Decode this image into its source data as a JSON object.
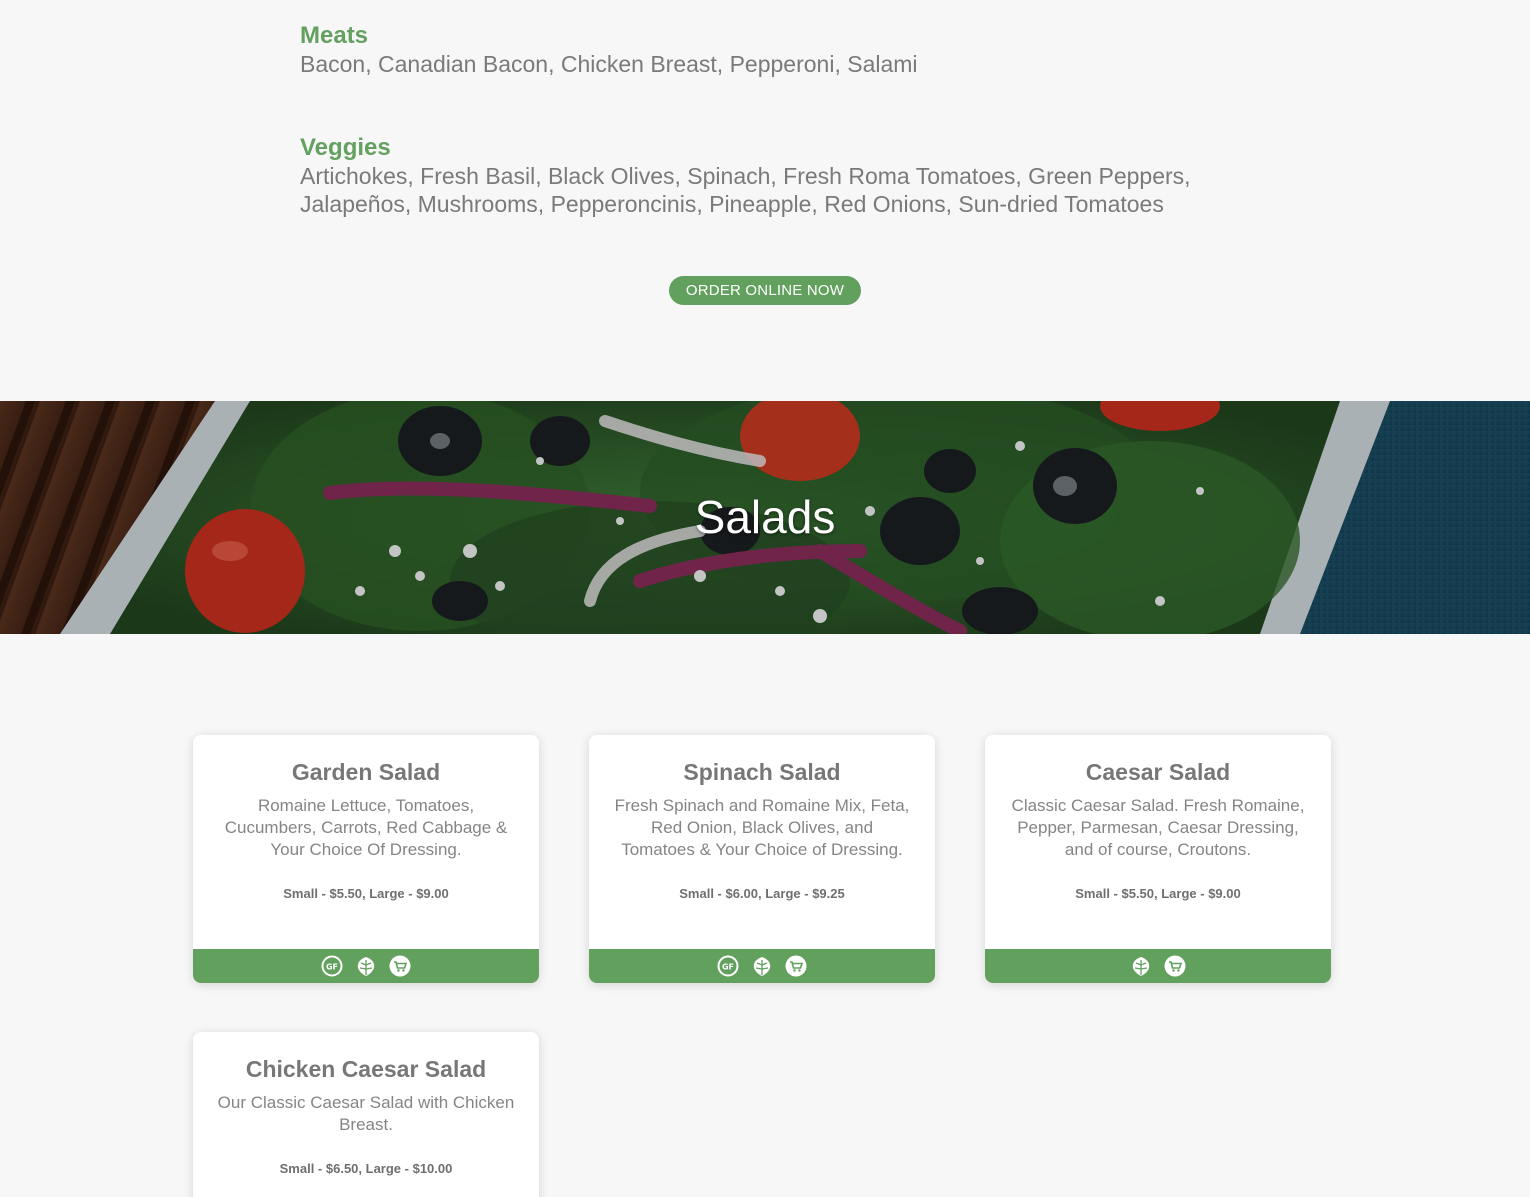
{
  "toppings": {
    "meats": {
      "heading": "Meats",
      "list": "Bacon, Canadian Bacon, Chicken Breast, Pepperoni, Salami"
    },
    "veggies": {
      "heading": "Veggies",
      "list": "Artichokes, Fresh Basil, Black Olives, Spinach, Fresh Roma Tomatoes, Green Peppers, Jalapeños, Mushrooms, Pepperoncinis, Pineapple, Red Onions, Sun-dried Tomatoes"
    }
  },
  "order_button": "ORDER ONLINE NOW",
  "hero": {
    "title": "Salads"
  },
  "cards": [
    {
      "title": "Garden Salad",
      "description": "Romaine Lettuce, Tomatoes, Cucumbers, Carrots, Red Cabbage & Your Choice Of Dressing.",
      "price": "Small - $5.50, Large - $9.00",
      "icons": [
        "gluten-free-icon",
        "vegetarian-leaf-icon",
        "cart-icon"
      ]
    },
    {
      "title": "Spinach Salad",
      "description": "Fresh Spinach and Romaine Mix, Feta, Red Onion, Black Olives, and Tomatoes & Your Choice of Dressing.",
      "price": "Small - $6.00, Large - $9.25",
      "icons": [
        "gluten-free-icon",
        "vegetarian-leaf-icon",
        "cart-icon"
      ]
    },
    {
      "title": "Caesar Salad",
      "description": "Classic Caesar Salad. Fresh Romaine, Pepper, Parmesan, Caesar Dressing, and of course, Croutons.",
      "price": "Small - $5.50, Large - $9.00",
      "icons": [
        "vegetarian-leaf-icon",
        "cart-icon"
      ]
    },
    {
      "title": "Chicken Caesar Salad",
      "description": "Our Classic Caesar Salad with Chicken Breast.",
      "price": "Small - $6.50, Large - $10.00",
      "icons": []
    }
  ],
  "colors": {
    "accent_green": "#62a05d",
    "heading_green": "#64a060",
    "background": "#f7f7f7"
  }
}
